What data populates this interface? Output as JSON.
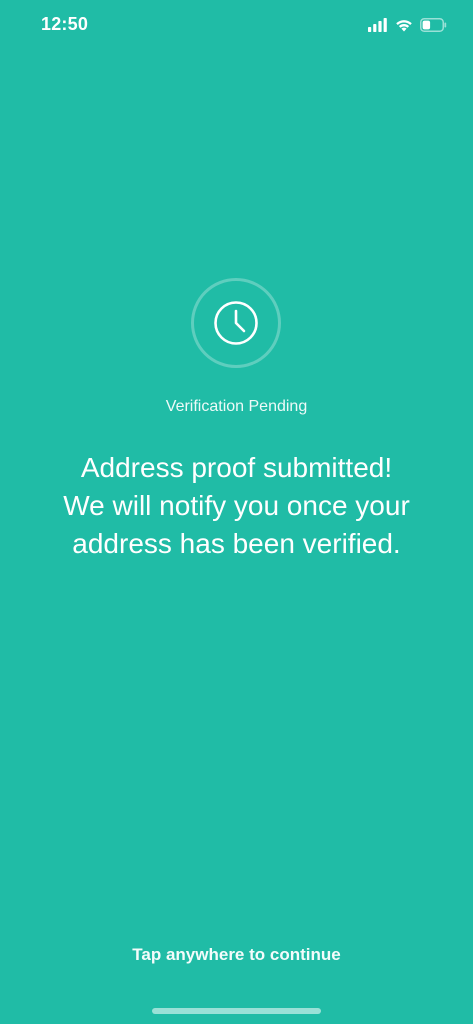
{
  "status_bar": {
    "time": "12:50",
    "icons": [
      "cellular-signal-icon",
      "wifi-icon",
      "battery-icon"
    ],
    "battery_level": 0.4
  },
  "pending": {
    "icon": "clock-icon",
    "label": "Verification Pending",
    "message_line1": "Address proof submitted!",
    "message_line2": "We will notify you once your",
    "message_line3": "address has been verified."
  },
  "footer": {
    "continue_hint": "Tap anywhere to continue"
  },
  "colors": {
    "background": "#20bca6",
    "foreground": "#ffffff"
  }
}
